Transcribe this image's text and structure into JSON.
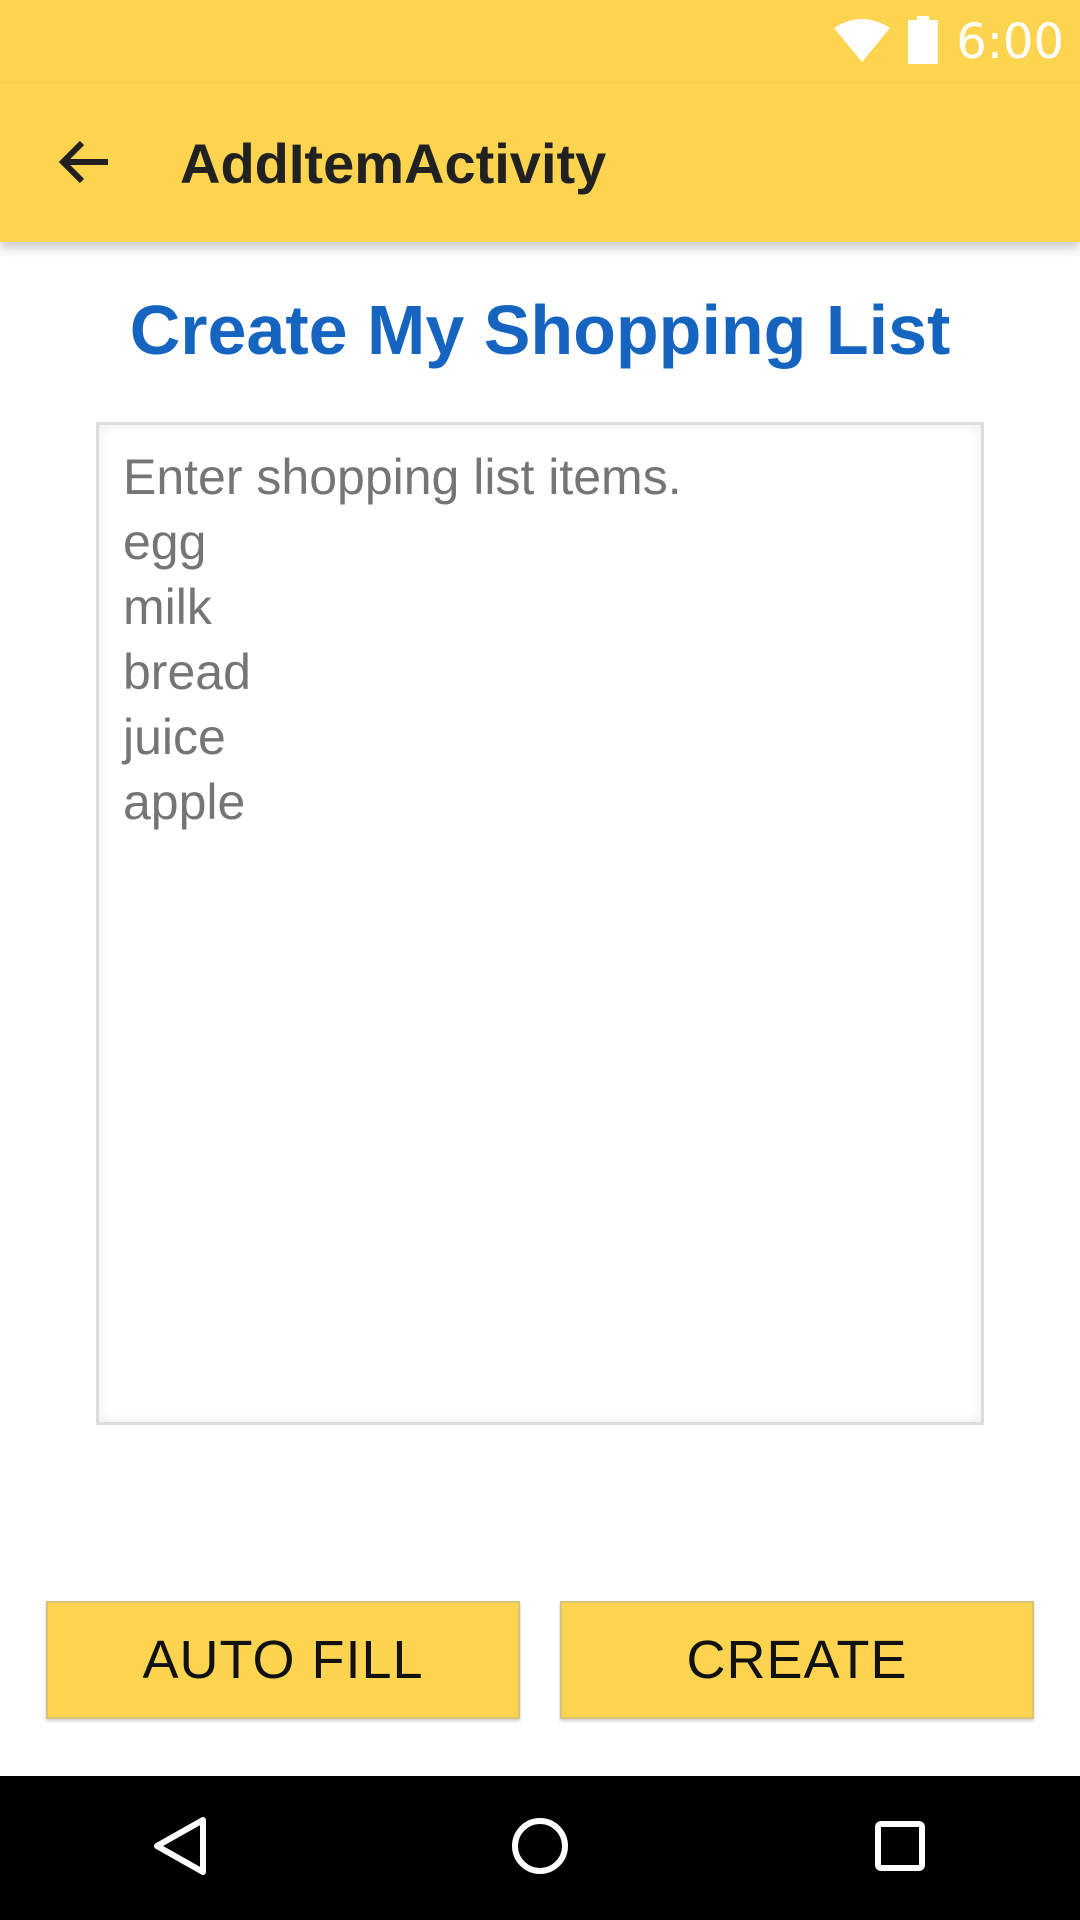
{
  "status_bar": {
    "time": "6:00",
    "icons": [
      "wifi-icon",
      "battery-icon"
    ]
  },
  "app_bar": {
    "title": "AddItemActivity",
    "back_icon": "arrow-back-icon"
  },
  "page": {
    "title": "Create My Shopping List"
  },
  "items_field": {
    "placeholder": "Enter shopping list items.\negg\nmilk\nbread\njuice\napple",
    "value": ""
  },
  "buttons": {
    "auto_fill": "AUTO FILL",
    "create": "CREATE"
  },
  "nav_bar": {
    "icons": [
      "nav-back-icon",
      "nav-home-icon",
      "nav-recents-icon"
    ]
  },
  "colors": {
    "accent_yellow": "#FDD44F",
    "title_blue": "#1565C0",
    "hint_gray": "#757575",
    "nav_black": "#000000"
  }
}
